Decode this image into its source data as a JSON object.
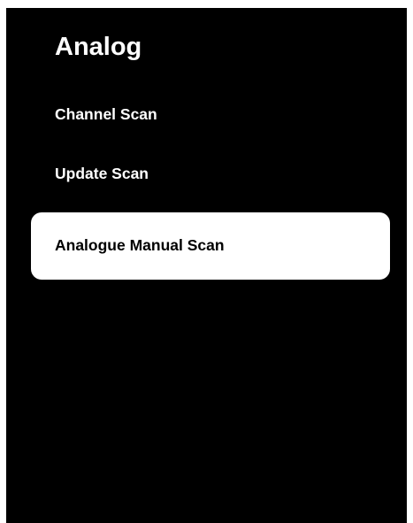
{
  "menu": {
    "title": "Analog",
    "items": [
      {
        "label": "Channel Scan",
        "selected": false
      },
      {
        "label": "Update Scan",
        "selected": false
      },
      {
        "label": "Analogue Manual Scan",
        "selected": true
      }
    ]
  },
  "colors": {
    "background": "#000000",
    "text": "#ffffff",
    "selected_background": "#ffffff",
    "selected_text": "#000000"
  }
}
